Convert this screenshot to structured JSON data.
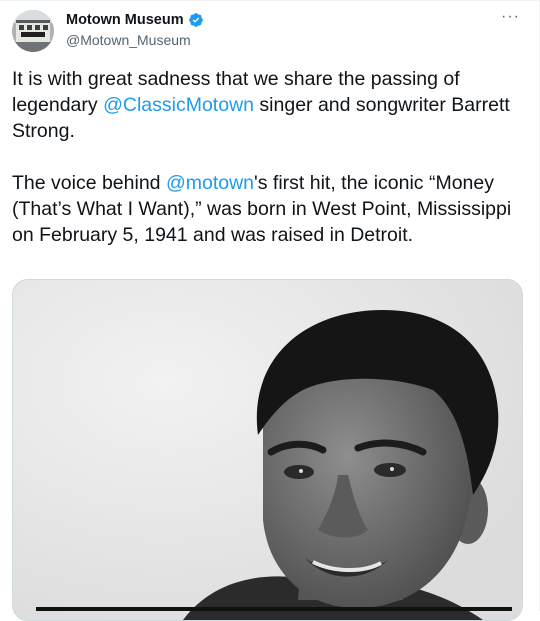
{
  "author": {
    "display_name": "Motown Museum",
    "handle": "@Motown_Museum",
    "verified": true,
    "verified_color": "#1d9bf0",
    "avatar_icon": "museum-building-avatar"
  },
  "more_icon": "more-options-icon",
  "tweet": {
    "p1_a": "It is with great sadness that we share the passing of legendary ",
    "p1_mention": "@ClassicMotown",
    "p1_b": " singer and songwriter Barrett Strong.",
    "p2_a": "The voice behind ",
    "p2_mention": "@motown",
    "p2_b": "'s first hit, the iconic “Money (That’s What I Want),” was born in West Point, Mississippi on February 5, 1941 and was raised in Detroit."
  },
  "media": {
    "kind": "black-and-white portrait photo",
    "icon": "photo-image"
  },
  "colors": {
    "text": "#0f1419",
    "secondary": "#536471",
    "link": "#1d9bf0",
    "border": "#cfd9de"
  }
}
